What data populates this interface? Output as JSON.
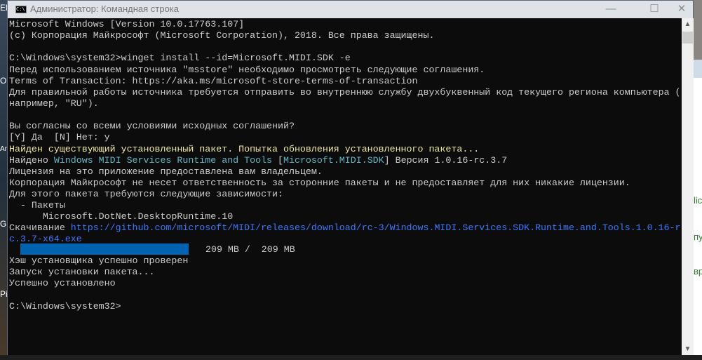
{
  "window": {
    "title": "Администратор: Командная строка",
    "icon": "cmd-icon",
    "icon_text": "C:\\",
    "minimize": "—",
    "maximize": "☐",
    "close": "✕"
  },
  "console": {
    "lines": [
      {
        "text": "Microsoft Windows [Version 10.0.17763.107]"
      },
      {
        "text": "(c) Корпорация Майкрософт (Microsoft Corporation), 2018. Все права защищены."
      },
      {
        "text": ""
      },
      {
        "text": "C:\\Windows\\system32>winget install --id=Microsoft.MIDI.SDK -e"
      },
      {
        "text": "Перед использованием источника \"msstore\" необходимо просмотреть следующие соглашения."
      },
      {
        "text": "Terms of Transaction: https://aka.ms/microsoft-store-terms-of-transaction"
      },
      {
        "text": "Для правильной работы источника требуется отправить во внутреннюю службу двухбуквенный код текущего региона компьютера ("
      },
      {
        "text": "например, \"RU\")."
      },
      {
        "text": ""
      },
      {
        "text": "Вы согласны со всеми условиями исходных соглашений?"
      },
      {
        "text": "[Y] Да  [N] Нет: y"
      },
      {
        "text": "Найден существующий установленный пакет. Попытка обновления установленного пакета..."
      },
      {
        "parts": [
          "Найдено ",
          "Windows MIDI Services Runtime and Tools",
          " [",
          "Microsoft.MIDI.SDK",
          "] Версия 1.0.16-rc.3.7"
        ]
      },
      {
        "text": "Лицензия на это приложение предоставлена вам владельцем."
      },
      {
        "text": "Корпорация Майкрософт не несет ответственность за сторонние пакеты и не предоставляет для них никакие лицензии."
      },
      {
        "text": "Для этого пакета требуются следующие зависимости:"
      },
      {
        "text": "  - Пакеты"
      },
      {
        "text": "      Microsoft.DotNet.DesktopRuntime.10"
      },
      {
        "parts": [
          "Скачивание ",
          "https://github.com/microsoft/MIDI/releases/download/rc-3/Windows.MIDI.Services.SDK.Runtime.and.Tools.1.0.16-r"
        ]
      },
      {
        "text": "c.3.7-x64.exe"
      },
      {
        "text": "209 MB /  209 MB"
      },
      {
        "text": "Хэш установщика успешно проверен"
      },
      {
        "text": "Запуск установки пакета..."
      },
      {
        "text": "Успешно установлено"
      },
      {
        "text": ""
      },
      {
        "text": "C:\\Windows\\system32>"
      }
    ],
    "download_progress": 1.0,
    "colors": {
      "text": "#cccccc",
      "warning": "#f1e9a0",
      "highlight": "#61b6c6",
      "link": "#3b78ff",
      "progress": "#0063b1"
    }
  },
  "scrollbar": {
    "up": "▲",
    "down": "▼"
  },
  "background": {
    "desktop_labels": [
      "El",
      "Or",
      "Arr",
      "Gic",
      "Pia"
    ],
    "right_app_labels": [
      "lic",
      "пу",
      "вр"
    ]
  }
}
